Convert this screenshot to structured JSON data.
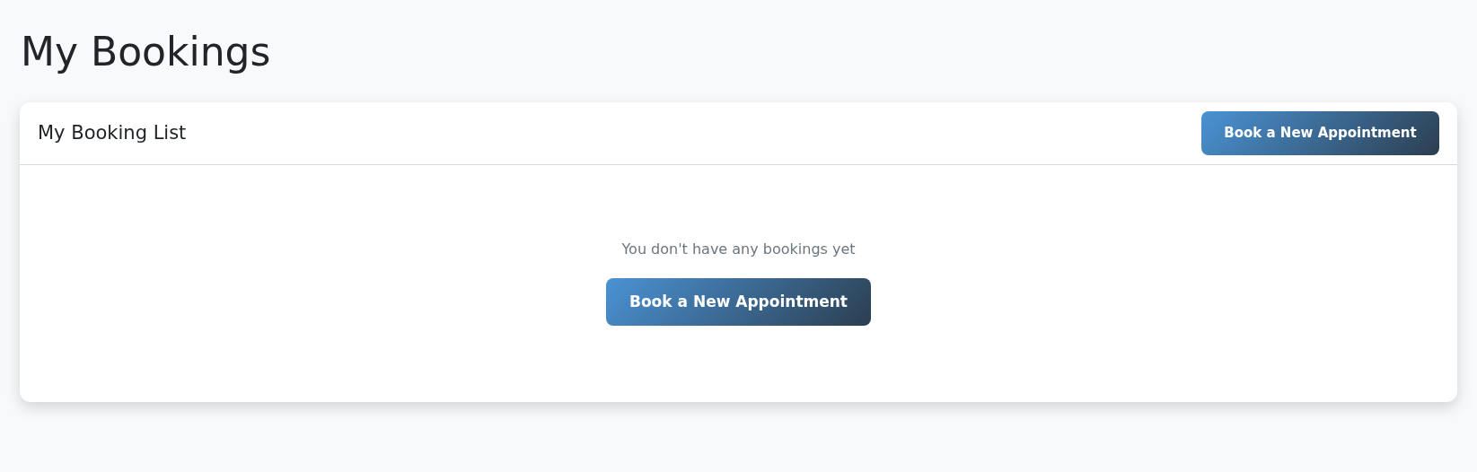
{
  "page_title": "My Bookings",
  "card": {
    "title": "My Booking List",
    "header_button": "Book a New Appointment",
    "empty_message": "You don't have any bookings yet",
    "empty_button": "Book a New Appointment"
  }
}
